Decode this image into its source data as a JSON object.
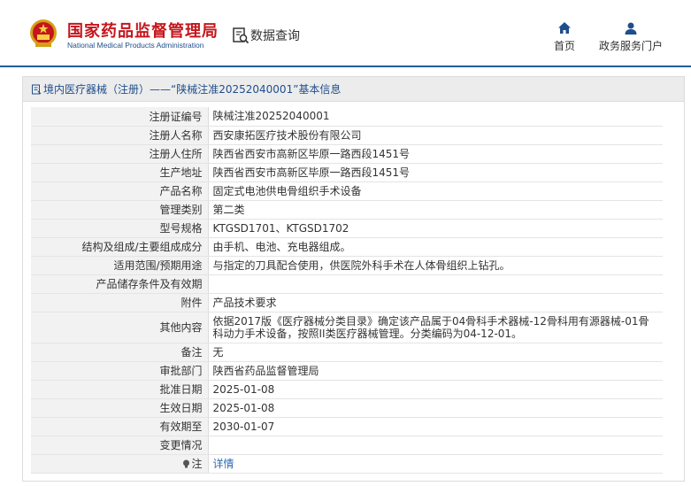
{
  "header": {
    "logo_cn": "国家药品监督管理局",
    "logo_en": "National Medical Products Administration",
    "query_label": "数据查询",
    "nav": [
      {
        "label": "首页",
        "icon": "home-icon"
      },
      {
        "label": "政务服务门户",
        "icon": "user-icon"
      }
    ]
  },
  "panel": {
    "title": "境内医疗器械（注册）——“陕械注准20252040001”基本信息",
    "rows": [
      {
        "label": "注册证编号",
        "value": "陕械注准20252040001"
      },
      {
        "label": "注册人名称",
        "value": "西安康拓医疗技术股份有限公司"
      },
      {
        "label": "注册人住所",
        "value": "陕西省西安市高新区毕原一路西段1451号"
      },
      {
        "label": "生产地址",
        "value": "陕西省西安市高新区毕原一路西段1451号"
      },
      {
        "label": "产品名称",
        "value": "固定式电池供电骨组织手术设备"
      },
      {
        "label": "管理类别",
        "value": "第二类"
      },
      {
        "label": "型号规格",
        "value": "KTGSD1701、KTGSD1702"
      },
      {
        "label": "结构及组成/主要组成成分",
        "value": "由手机、电池、充电器组成。"
      },
      {
        "label": "适用范围/预期用途",
        "value": "与指定的刀具配合使用，供医院外科手术在人体骨组织上钻孔。"
      },
      {
        "label": "产品储存条件及有效期",
        "value": ""
      },
      {
        "label": "附件",
        "value": "产品技术要求"
      },
      {
        "label": "其他内容",
        "value": "依据2017版《医疗器械分类目录》确定该产品属于04骨科手术器械-12骨科用有源器械-01骨科动力手术设备，按照II类医疗器械管理。分类编码为04-12-01。"
      },
      {
        "label": "备注",
        "value": "无"
      },
      {
        "label": "审批部门",
        "value": "陕西省药品监督管理局"
      },
      {
        "label": "批准日期",
        "value": "2025-01-08"
      },
      {
        "label": "生效日期",
        "value": "2025-01-08"
      },
      {
        "label": "有效期至",
        "value": "2030-01-07"
      },
      {
        "label": "变更情况",
        "value": ""
      }
    ],
    "note_label": "注",
    "note_link": "详情"
  },
  "colors": {
    "brand_red": "#c4161c",
    "brand_blue": "#1f5f9e",
    "link": "#2d6ab5"
  }
}
